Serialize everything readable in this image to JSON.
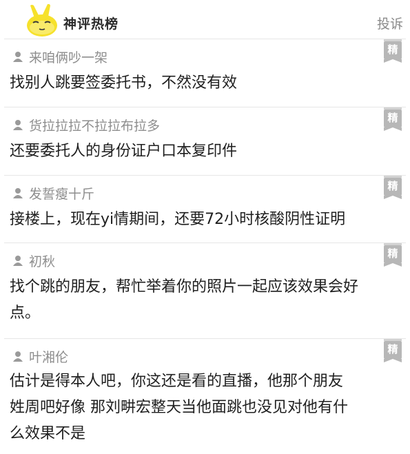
{
  "header": {
    "title": "神评热榜",
    "report_label": "投诉"
  },
  "badge_label": "精",
  "comments": [
    {
      "username": "来咱俩吵一架",
      "lines": [
        "找别人跳要签委托书，不然没有效"
      ]
    },
    {
      "username": "货拉拉拉不拉拉布拉多",
      "lines": [
        "还要委托人的身份证户口本复印件"
      ]
    },
    {
      "username": "发誓瘦十斤",
      "lines": [
        "接楼上，现在yi情期间，还要72小时核酸阴性证明"
      ]
    },
    {
      "username": "初秋",
      "lines": [
        "找个跳的朋友，帮忙举着你的照片一起应该效果会好",
        "点。"
      ]
    },
    {
      "username": "叶湘伦",
      "lines": [
        "估计是得本人吧，你这还是看的直播，他那个朋友",
        "姓周吧好像 那刘畊宏整天当他面跳也没见对他有什",
        "么效果不是"
      ]
    }
  ],
  "colors": {
    "badge": "#b7b7b7",
    "username": "#8e8e8e",
    "body_text": "#1f1f1f",
    "logo_yellow": "#f6e12c"
  },
  "icons": {
    "logo": "yellow-mascot-logo",
    "user": "user-silhouette-icon",
    "badge": "essence-badge"
  }
}
